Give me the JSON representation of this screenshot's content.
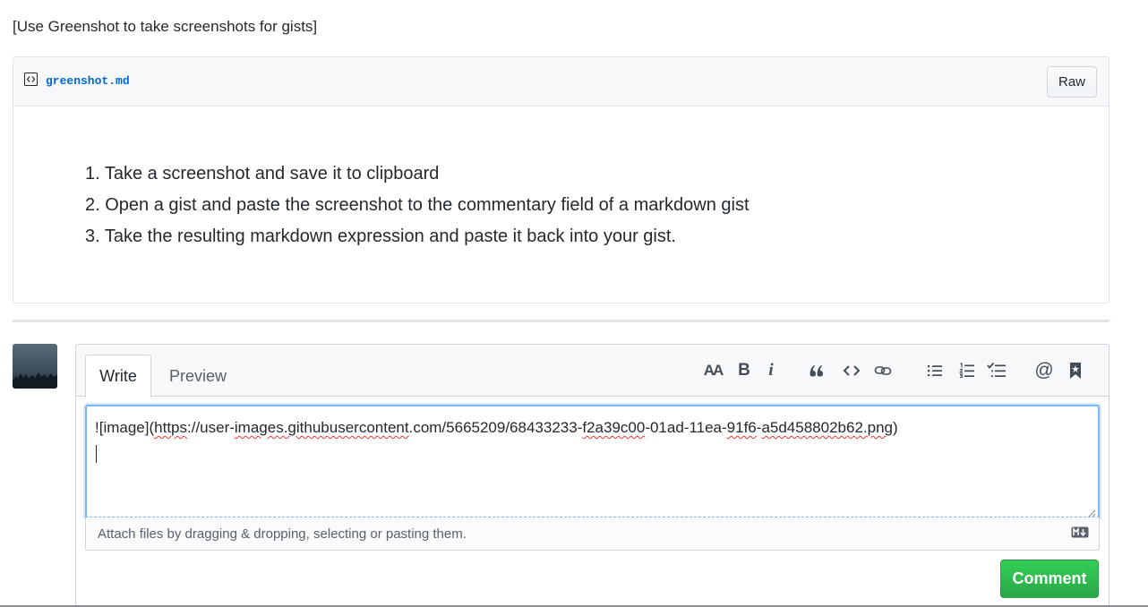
{
  "gist": {
    "description": "[Use Greenshot to take screenshots for gists]",
    "file_name": "greenshot.md",
    "raw_label": "Raw",
    "content_items": [
      "1. Take a screenshot and save it to clipboard",
      "2. Open a gist and paste the screenshot to the commentary field of a markdown gist",
      "3. Take the resulting markdown expression and paste it back into your gist."
    ]
  },
  "comment_form": {
    "tabs": {
      "write": "Write",
      "preview": "Preview"
    },
    "toolbar": {
      "header": "AA",
      "bold": "B",
      "italic": "i",
      "mention": "@"
    },
    "textarea": {
      "parts": [
        "![image](",
        "https",
        "://user-",
        "images.githubusercontent",
        ".com/5665209/68433233-",
        "f2a39c00",
        "-01ad-11ea-",
        "91f6",
        "-",
        "a5d458802b62.png",
        ")"
      ]
    },
    "attach_hint": "Attach files by dragging & dropping, selecting or pasting them.",
    "submit_label": "Comment"
  },
  "colors": {
    "link": "#0366d6",
    "primary_button": "#28a745",
    "focus_border": "#79b8ff",
    "spellcheck": "#e53935"
  }
}
